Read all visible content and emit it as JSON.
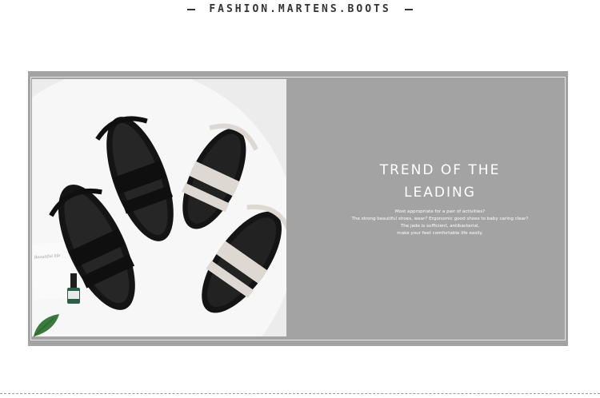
{
  "header": {
    "brand": "FASHION.MARTENS.BOOTS"
  },
  "banner": {
    "headline_line1": "TREND OF THE",
    "headline_line2": "LEADING",
    "copy_lines": [
      "Most appropriate for a pair of activities?",
      "The strong beautiful shoes, wear? Ergonomic good shoes to baby caring clear?",
      "The jade is sufficient, antibacterial,",
      "make your feet comfortable life easily."
    ],
    "notebook_text": "Beautiful life"
  }
}
